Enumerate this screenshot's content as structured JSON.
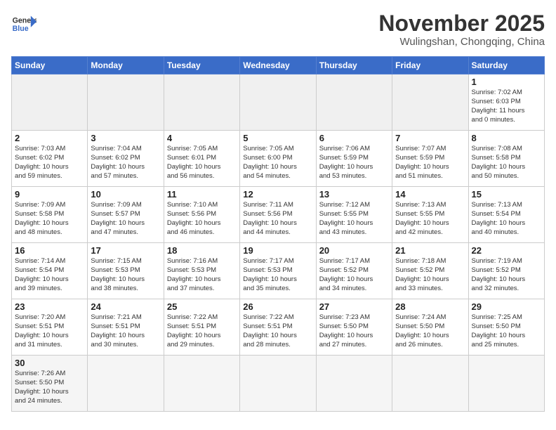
{
  "header": {
    "logo_general": "General",
    "logo_blue": "Blue",
    "month_title": "November 2025",
    "location": "Wulingshan, Chongqing, China"
  },
  "weekdays": [
    "Sunday",
    "Monday",
    "Tuesday",
    "Wednesday",
    "Thursday",
    "Friday",
    "Saturday"
  ],
  "weeks": [
    [
      {
        "day": "",
        "empty": true
      },
      {
        "day": "",
        "empty": true
      },
      {
        "day": "",
        "empty": true
      },
      {
        "day": "",
        "empty": true
      },
      {
        "day": "",
        "empty": true
      },
      {
        "day": "",
        "empty": true
      },
      {
        "day": "1",
        "sunrise": "7:02 AM",
        "sunset": "6:03 PM",
        "daylight_h": "11",
        "daylight_m": "0"
      }
    ],
    [
      {
        "day": "2",
        "sunrise": "7:03 AM",
        "sunset": "6:02 PM",
        "daylight_h": "10",
        "daylight_m": "59"
      },
      {
        "day": "3",
        "sunrise": "7:04 AM",
        "sunset": "6:02 PM",
        "daylight_h": "10",
        "daylight_m": "57"
      },
      {
        "day": "4",
        "sunrise": "7:05 AM",
        "sunset": "6:01 PM",
        "daylight_h": "10",
        "daylight_m": "56"
      },
      {
        "day": "5",
        "sunrise": "7:05 AM",
        "sunset": "6:00 PM",
        "daylight_h": "10",
        "daylight_m": "54"
      },
      {
        "day": "6",
        "sunrise": "7:06 AM",
        "sunset": "5:59 PM",
        "daylight_h": "10",
        "daylight_m": "53"
      },
      {
        "day": "7",
        "sunrise": "7:07 AM",
        "sunset": "5:59 PM",
        "daylight_h": "10",
        "daylight_m": "51"
      },
      {
        "day": "8",
        "sunrise": "7:08 AM",
        "sunset": "5:58 PM",
        "daylight_h": "10",
        "daylight_m": "50"
      }
    ],
    [
      {
        "day": "9",
        "sunrise": "7:09 AM",
        "sunset": "5:58 PM",
        "daylight_h": "10",
        "daylight_m": "48"
      },
      {
        "day": "10",
        "sunrise": "7:09 AM",
        "sunset": "5:57 PM",
        "daylight_h": "10",
        "daylight_m": "47"
      },
      {
        "day": "11",
        "sunrise": "7:10 AM",
        "sunset": "5:56 PM",
        "daylight_h": "10",
        "daylight_m": "46"
      },
      {
        "day": "12",
        "sunrise": "7:11 AM",
        "sunset": "5:56 PM",
        "daylight_h": "10",
        "daylight_m": "44"
      },
      {
        "day": "13",
        "sunrise": "7:12 AM",
        "sunset": "5:55 PM",
        "daylight_h": "10",
        "daylight_m": "43"
      },
      {
        "day": "14",
        "sunrise": "7:13 AM",
        "sunset": "5:55 PM",
        "daylight_h": "10",
        "daylight_m": "42"
      },
      {
        "day": "15",
        "sunrise": "7:13 AM",
        "sunset": "5:54 PM",
        "daylight_h": "10",
        "daylight_m": "40"
      }
    ],
    [
      {
        "day": "16",
        "sunrise": "7:14 AM",
        "sunset": "5:54 PM",
        "daylight_h": "10",
        "daylight_m": "39"
      },
      {
        "day": "17",
        "sunrise": "7:15 AM",
        "sunset": "5:53 PM",
        "daylight_h": "10",
        "daylight_m": "38"
      },
      {
        "day": "18",
        "sunrise": "7:16 AM",
        "sunset": "5:53 PM",
        "daylight_h": "10",
        "daylight_m": "37"
      },
      {
        "day": "19",
        "sunrise": "7:17 AM",
        "sunset": "5:53 PM",
        "daylight_h": "10",
        "daylight_m": "35"
      },
      {
        "day": "20",
        "sunrise": "7:17 AM",
        "sunset": "5:52 PM",
        "daylight_h": "10",
        "daylight_m": "34"
      },
      {
        "day": "21",
        "sunrise": "7:18 AM",
        "sunset": "5:52 PM",
        "daylight_h": "10",
        "daylight_m": "33"
      },
      {
        "day": "22",
        "sunrise": "7:19 AM",
        "sunset": "5:52 PM",
        "daylight_h": "10",
        "daylight_m": "32"
      }
    ],
    [
      {
        "day": "23",
        "sunrise": "7:20 AM",
        "sunset": "5:51 PM",
        "daylight_h": "10",
        "daylight_m": "31"
      },
      {
        "day": "24",
        "sunrise": "7:21 AM",
        "sunset": "5:51 PM",
        "daylight_h": "10",
        "daylight_m": "30"
      },
      {
        "day": "25",
        "sunrise": "7:22 AM",
        "sunset": "5:51 PM",
        "daylight_h": "10",
        "daylight_m": "29"
      },
      {
        "day": "26",
        "sunrise": "7:22 AM",
        "sunset": "5:51 PM",
        "daylight_h": "10",
        "daylight_m": "28"
      },
      {
        "day": "27",
        "sunrise": "7:23 AM",
        "sunset": "5:50 PM",
        "daylight_h": "10",
        "daylight_m": "27"
      },
      {
        "day": "28",
        "sunrise": "7:24 AM",
        "sunset": "5:50 PM",
        "daylight_h": "10",
        "daylight_m": "26"
      },
      {
        "day": "29",
        "sunrise": "7:25 AM",
        "sunset": "5:50 PM",
        "daylight_h": "10",
        "daylight_m": "25"
      }
    ],
    [
      {
        "day": "30",
        "sunrise": "7:26 AM",
        "sunset": "5:50 PM",
        "daylight_h": "10",
        "daylight_m": "24"
      },
      {
        "day": "",
        "empty": true
      },
      {
        "day": "",
        "empty": true
      },
      {
        "day": "",
        "empty": true
      },
      {
        "day": "",
        "empty": true
      },
      {
        "day": "",
        "empty": true
      },
      {
        "day": "",
        "empty": true
      }
    ]
  ]
}
